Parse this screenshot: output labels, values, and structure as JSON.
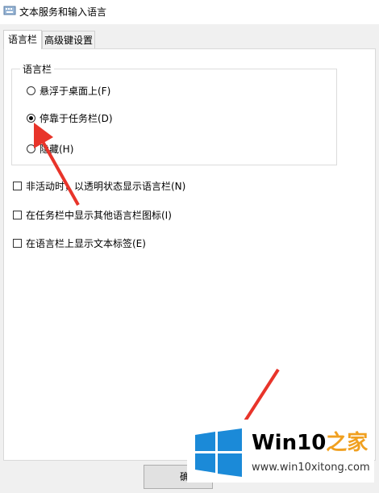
{
  "window": {
    "title": "文本服务和输入语言"
  },
  "tabs": [
    {
      "label": "语言栏",
      "active": true
    },
    {
      "label": "高级键设置",
      "active": false
    }
  ],
  "language_bar_group": {
    "title": "语言栏",
    "options": [
      {
        "label": "悬浮于桌面上(F)",
        "checked": false
      },
      {
        "label": "停靠于任务栏(D)",
        "checked": true
      },
      {
        "label": "隐藏(H)",
        "checked": false
      }
    ]
  },
  "checkboxes": [
    {
      "label": "非活动时，以透明状态显示语言栏(N)",
      "checked": false
    },
    {
      "label": "在任务栏中显示其他语言栏图标(I)",
      "checked": false
    },
    {
      "label": "在语言栏上显示文本标签(E)",
      "checked": false
    }
  ],
  "footer": {
    "ok_label": "确"
  },
  "watermark": {
    "brand_part1": "Win10",
    "brand_part2": "之家",
    "url": "www.win10xitong.com"
  },
  "colors": {
    "arrow": "#e8342a",
    "win_blue": "#1b8ad8"
  }
}
